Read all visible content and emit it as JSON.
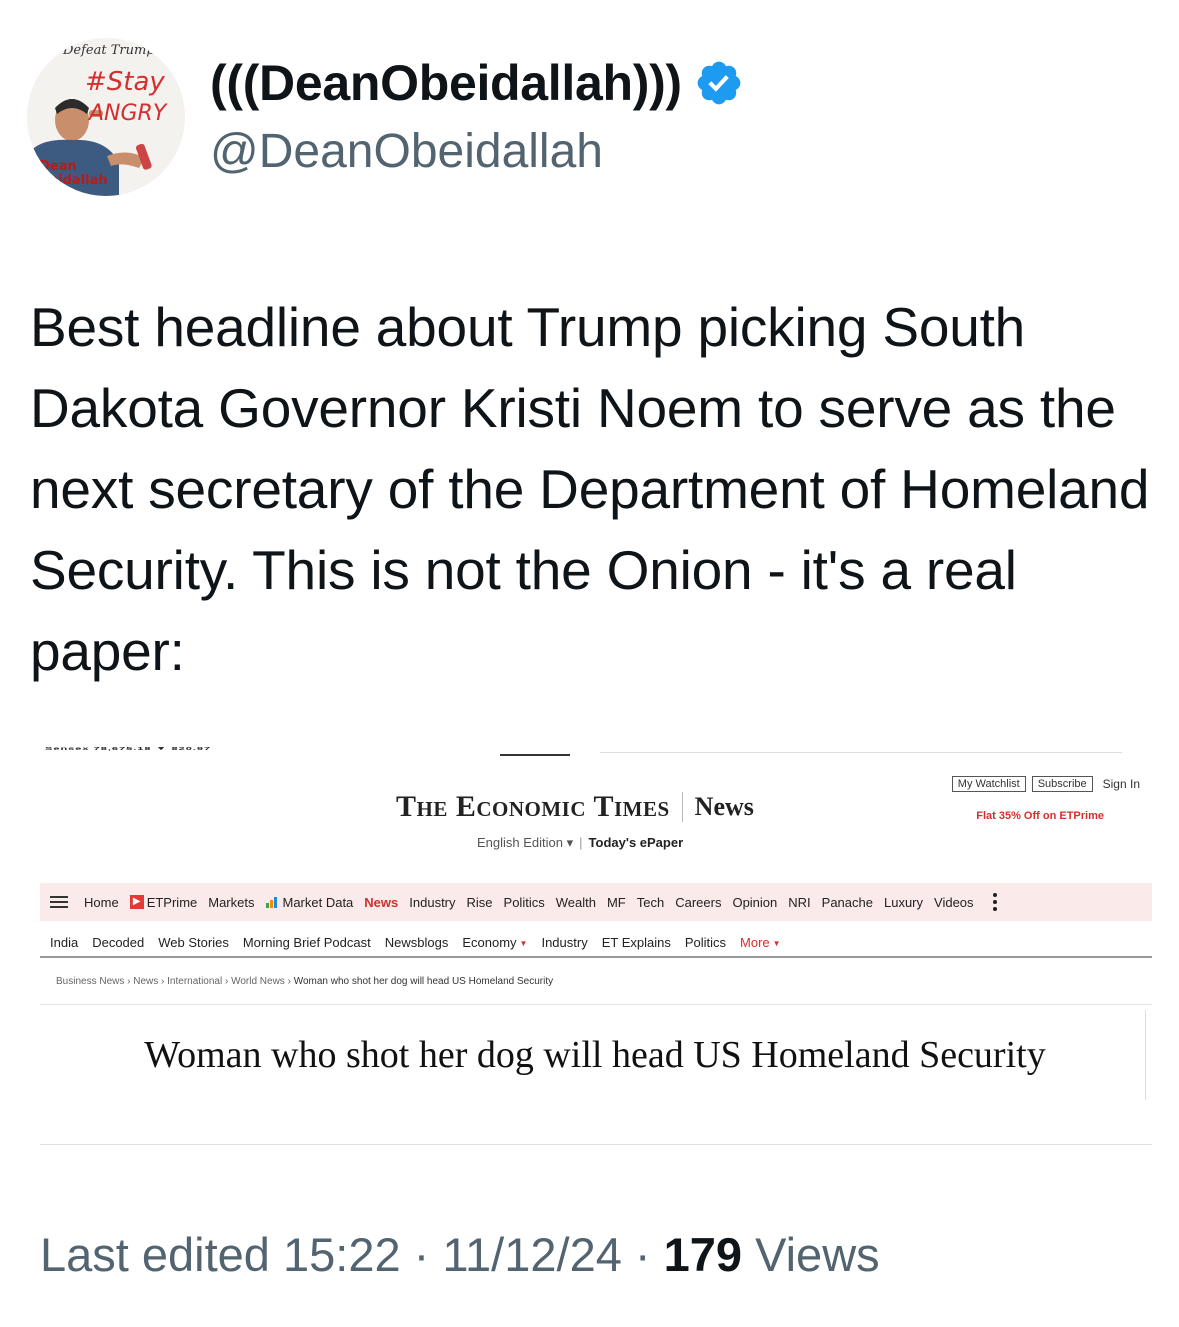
{
  "author": {
    "display_name": "(((DeanObeidallah)))",
    "handle": "@DeanObeidallah",
    "verified_icon": "verified-badge-icon",
    "avatar_text": {
      "top": "Defeat Trump",
      "hashtag": "#Stay",
      "angry": "ANGRY",
      "name_top": "Dean",
      "name_bottom": "Obeidallah"
    }
  },
  "tweet": {
    "text": "Best headline about Trump picking South Dakota Governor Kristi Noem to serve as the next secretary of the Department of Homeland Security. This is not the Onion - it's a real paper:"
  },
  "embedded_article": {
    "ticker": "Sensex 78,675.18 ▼ 820.97",
    "brand": "The Economic Times",
    "section": "News",
    "edition": "English Edition",
    "epaper": "Today's ePaper",
    "buttons": {
      "watchlist": "My Watchlist",
      "subscribe": "Subscribe",
      "signin": "Sign In"
    },
    "promo": "Flat 35% Off on ETPrime",
    "nav": [
      "Home",
      "ETPrime",
      "Markets",
      "Market Data",
      "News",
      "Industry",
      "Rise",
      "Politics",
      "Wealth",
      "MF",
      "Tech",
      "Careers",
      "Opinion",
      "NRI",
      "Panache",
      "Luxury",
      "Videos"
    ],
    "subnav": [
      "India",
      "Decoded",
      "Web Stories",
      "Morning Brief Podcast",
      "Newsblogs",
      "Economy",
      "Industry",
      "ET Explains",
      "Politics",
      "More"
    ],
    "breadcrumbs": [
      "Business News",
      "News",
      "International",
      "World News"
    ],
    "breadcrumb_current": "Woman who shot her dog will head US Homeland Security",
    "headline": "Woman who shot her dog will head US Homeland Security",
    "colors": {
      "accent": "#d32f2f",
      "nav_bg": "#fbeaea"
    }
  },
  "meta": {
    "edited": "Last edited 15:22 · 11/12/24",
    "separator": " · ",
    "views_count": "179",
    "views_label": " Views"
  }
}
